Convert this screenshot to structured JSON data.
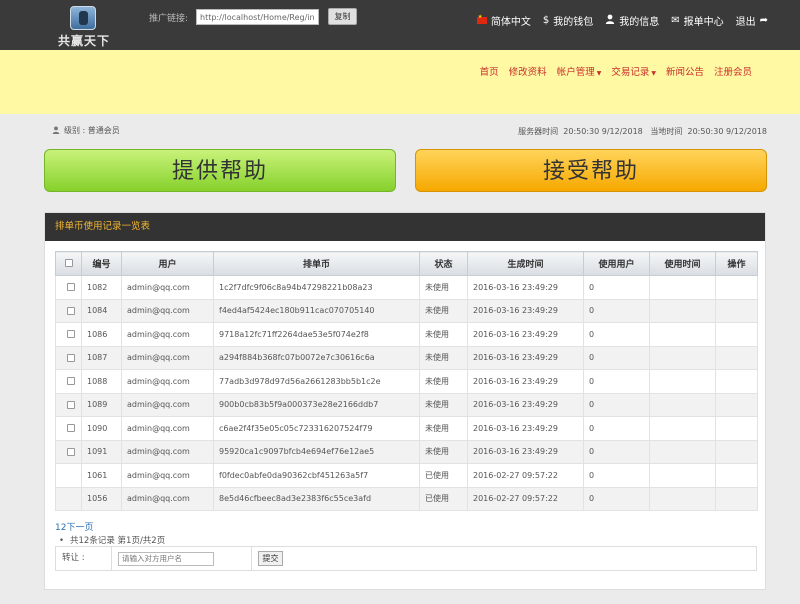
{
  "header": {
    "logo_text": "共赢天下",
    "promo_label": "推广链接:",
    "promo_value": "http://localhost/Home/Reg/index/u",
    "copy_label": "复制",
    "links": [
      {
        "icon": "china-flag-icon",
        "label": "简体中文"
      },
      {
        "icon": "dollar-icon",
        "label": "我的钱包"
      },
      {
        "icon": "user-icon",
        "label": "我的信息"
      },
      {
        "icon": "envelope-icon",
        "label": "报单中心"
      },
      {
        "icon": "logout-arrow-icon",
        "label": "退出"
      }
    ]
  },
  "nav": {
    "items": [
      "首页",
      "修改资料",
      "帐户管理",
      "交易记录",
      "新闻公告",
      "注册会员"
    ]
  },
  "status": {
    "level_label": "级别 : 普通会员",
    "server_time_label": "服务器时间",
    "server_time": "20:50:30 9/12/2018",
    "local_time_label": "当地时间",
    "local_time": "20:50:30 9/12/2018"
  },
  "actions": {
    "provide_help": "提供帮助",
    "accept_help": "接受帮助"
  },
  "panel": {
    "title": "排单币使用记录一览表",
    "columns": [
      "编号",
      "用户",
      "排单币",
      "状态",
      "生成时间",
      "使用用户",
      "使用时间",
      "操作"
    ],
    "rows": [
      {
        "id": "1082",
        "user": "admin@qq.com",
        "coin": "1c2f7dfc9f06c8a94b47298221b08a23",
        "status": "未使用",
        "created": "2016-03-16 23:49:29",
        "used_by": "0",
        "used_at": "",
        "op": "",
        "checkbox": true
      },
      {
        "id": "1084",
        "user": "admin@qq.com",
        "coin": "f4ed4af5424ec180b911cac070705140",
        "status": "未使用",
        "created": "2016-03-16 23:49:29",
        "used_by": "0",
        "used_at": "",
        "op": "",
        "checkbox": true
      },
      {
        "id": "1086",
        "user": "admin@qq.com",
        "coin": "9718a12fc71ff2264dae53e5f074e2f8",
        "status": "未使用",
        "created": "2016-03-16 23:49:29",
        "used_by": "0",
        "used_at": "",
        "op": "",
        "checkbox": true
      },
      {
        "id": "1087",
        "user": "admin@qq.com",
        "coin": "a294f884b368fc07b0072e7c30616c6a",
        "status": "未使用",
        "created": "2016-03-16 23:49:29",
        "used_by": "0",
        "used_at": "",
        "op": "",
        "checkbox": true
      },
      {
        "id": "1088",
        "user": "admin@qq.com",
        "coin": "77adb3d978d97d56a2661283bb5b1c2e",
        "status": "未使用",
        "created": "2016-03-16 23:49:29",
        "used_by": "0",
        "used_at": "",
        "op": "",
        "checkbox": true
      },
      {
        "id": "1089",
        "user": "admin@qq.com",
        "coin": "900b0cb83b5f9a000373e28e2166ddb7",
        "status": "未使用",
        "created": "2016-03-16 23:49:29",
        "used_by": "0",
        "used_at": "",
        "op": "",
        "checkbox": true
      },
      {
        "id": "1090",
        "user": "admin@qq.com",
        "coin": "c6ae2f4f35e05c05c723316207524f79",
        "status": "未使用",
        "created": "2016-03-16 23:49:29",
        "used_by": "0",
        "used_at": "",
        "op": "",
        "checkbox": true
      },
      {
        "id": "1091",
        "user": "admin@qq.com",
        "coin": "95920ca1c9097bfcb4e694ef76e12ae5",
        "status": "未使用",
        "created": "2016-03-16 23:49:29",
        "used_by": "0",
        "used_at": "",
        "op": "",
        "checkbox": true
      },
      {
        "id": "1061",
        "user": "admin@qq.com",
        "coin": "f0fdec0abfe0da90362cbf451263a5f7",
        "status": "已使用",
        "created": "2016-02-27 09:57:22",
        "used_by": "0",
        "used_at": "",
        "op": "",
        "checkbox": false
      },
      {
        "id": "1056",
        "user": "admin@qq.com",
        "coin": "8e5d46cfbeec8ad3e2383f6c55ce3afd",
        "status": "已使用",
        "created": "2016-02-27 09:57:22",
        "used_by": "0",
        "used_at": "",
        "op": "",
        "checkbox": false
      }
    ],
    "pager_link": "12下一页",
    "summary": "共12条记录 第1页/共2页"
  },
  "transfer": {
    "label": "转让 :",
    "placeholder": "请输入对方用户名",
    "submit_label": "提交"
  },
  "colors": {
    "topbar": "#3a3a3a",
    "band": "#fff9a3",
    "nav_link": "#c8302d",
    "panel_title": "#f2b632",
    "provide_green": "#86d12c",
    "accept_orange": "#f6a800"
  }
}
